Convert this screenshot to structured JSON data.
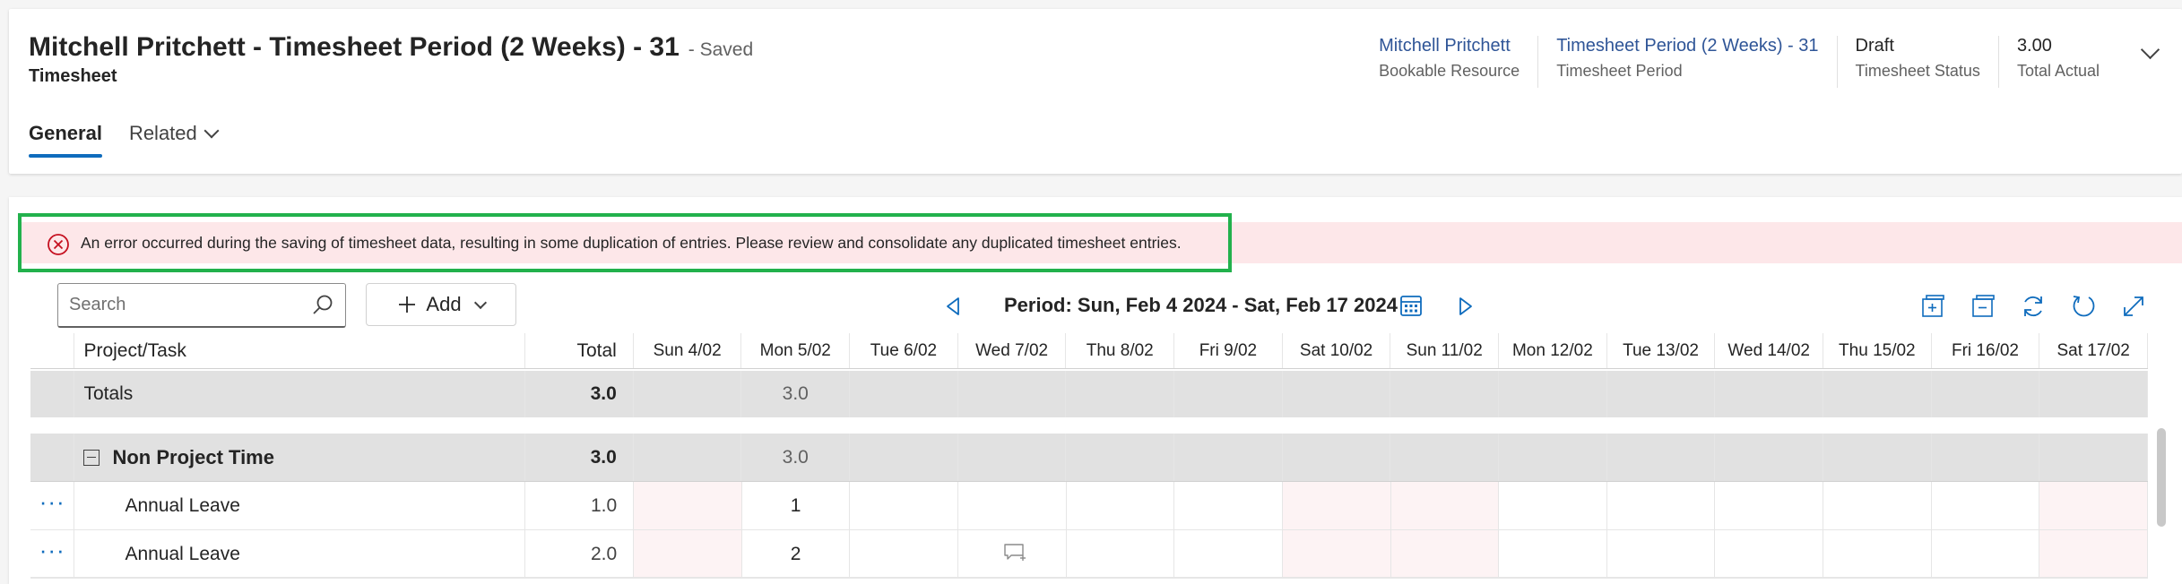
{
  "header": {
    "title": "Mitchell Pritchett - Timesheet Period (2 Weeks) - 31",
    "save_status": "- Saved",
    "entity_type": "Timesheet",
    "fields": [
      {
        "value": "Mitchell Pritchett",
        "label": "Bookable Resource",
        "is_link": true
      },
      {
        "value": "Timesheet Period (2 Weeks) - 31",
        "label": "Timesheet Period",
        "is_link": true
      },
      {
        "value": "Draft",
        "label": "Timesheet Status",
        "is_link": false
      },
      {
        "value": "3.00",
        "label": "Total Actual",
        "is_link": false
      }
    ],
    "tabs": [
      {
        "label": "General",
        "active": true
      },
      {
        "label": "Related",
        "active": false
      }
    ]
  },
  "error": {
    "message": "An error occurred during the saving of timesheet data, resulting in some duplication of entries. Please review and consolidate any duplicated timesheet entries.",
    "icon": "error-circle-icon",
    "highlight_color": "#22b14c"
  },
  "toolbar": {
    "search_placeholder": "Search",
    "add_label": "Add",
    "period_label": "Period: Sun, Feb 4 2024 - Sat, Feb 17 2024",
    "icons": [
      "expand-all-icon",
      "collapse-all-icon",
      "refresh-icon",
      "reset-icon",
      "fullscreen-icon"
    ]
  },
  "table": {
    "columns": {
      "name": "Project/Task",
      "total": "Total",
      "days": [
        "Sun 4/02",
        "Mon 5/02",
        "Tue 6/02",
        "Wed 7/02",
        "Thu 8/02",
        "Fri 9/02",
        "Sat 10/02",
        "Sun 11/02",
        "Mon 12/02",
        "Tue 13/02",
        "Wed 14/02",
        "Thu 15/02",
        "Fri 16/02",
        "Sat 17/02"
      ]
    },
    "totals": {
      "label": "Totals",
      "total": "3.0",
      "days": [
        "",
        "3.0",
        "",
        "",
        "",
        "",
        "",
        "",
        "",
        "",
        "",
        "",
        "",
        ""
      ]
    },
    "group": {
      "label": "Non Project Time",
      "total": "3.0",
      "days": [
        "",
        "3.0",
        "",
        "",
        "",
        "",
        "",
        "",
        "",
        "",
        "",
        "",
        "",
        ""
      ]
    },
    "rows": [
      {
        "more": "···",
        "label": "Annual Leave",
        "total": "1.0",
        "days": [
          "",
          "1",
          "",
          "",
          "",
          "",
          "",
          "",
          "",
          "",
          "",
          "",
          "",
          ""
        ]
      },
      {
        "more": "···",
        "label": "Annual Leave",
        "total": "2.0",
        "days": [
          "",
          "2",
          "",
          "",
          "",
          "",
          "",
          "",
          "",
          "",
          "",
          "",
          "",
          ""
        ]
      }
    ]
  },
  "colors": {
    "accent": "#0f6cbd",
    "link": "#2f5597",
    "error_bg": "#fde7e9",
    "error_icon": "#c50f1f",
    "row_gray": "#e1e1e1",
    "weekend": "#fdf3f4"
  }
}
